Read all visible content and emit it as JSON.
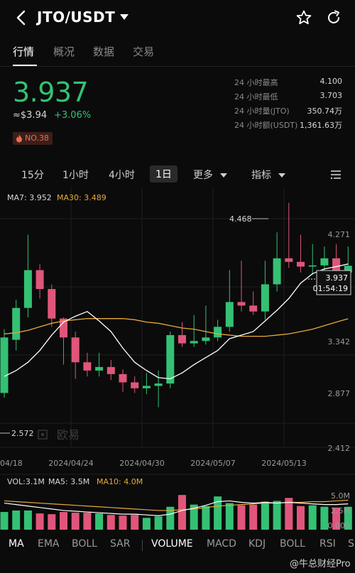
{
  "header": {
    "pair": "JTO/USDT"
  },
  "tabs": [
    {
      "label": "行情",
      "active": true
    },
    {
      "label": "概况",
      "active": false
    },
    {
      "label": "数据",
      "active": false
    },
    {
      "label": "交易",
      "active": false
    }
  ],
  "ticker": {
    "price": "3.937",
    "approx_price": "≈$3.94",
    "change": "+3.06%",
    "hot_rank": "NO.38"
  },
  "stats": [
    {
      "label": "24 小时最高",
      "value": "4.100"
    },
    {
      "label": "24 小时最低",
      "value": "3.703"
    },
    {
      "label": "24 小时量(JTO)",
      "value": "350.74万"
    },
    {
      "label": "24 小时额(USDT)",
      "value": "1,361.63万"
    }
  ],
  "intervals": [
    {
      "label": "15分",
      "active": false
    },
    {
      "label": "1小时",
      "active": false
    },
    {
      "label": "4小时",
      "active": false
    },
    {
      "label": "1日",
      "active": true
    },
    {
      "label": "更多",
      "active": false
    },
    {
      "label": "指标",
      "active": false
    }
  ],
  "indicators": {
    "ma7": "MA7: 3.952",
    "ma30": "MA30: 3.489"
  },
  "price_axis": [
    "4.271",
    "3.342",
    "2.877",
    "2.412"
  ],
  "date_axis": [
    "04/18",
    "2024/04/24",
    "2024/04/30",
    "2024/05/07",
    "2024/05/13"
  ],
  "high_marker": "4.468",
  "low_marker": "2.572",
  "current_tag": {
    "price": "3.937",
    "countdown": "01:54:19"
  },
  "watermark_brand": "欧易",
  "volume": {
    "vol": "VOL:3.1M",
    "ma5": "MA5: 3.5M",
    "ma10": "MA10: 4.0M",
    "axis": [
      "5.0M",
      "2.5M",
      "0.000"
    ]
  },
  "bottom_tabs": [
    {
      "label": "MA",
      "active": true
    },
    {
      "label": "EMA",
      "active": false
    },
    {
      "label": "BOLL",
      "active": false
    },
    {
      "label": "SAR",
      "active": false
    },
    {
      "label": "VOLUME",
      "active": true
    },
    {
      "label": "MACD",
      "active": false
    },
    {
      "label": "KDJ",
      "active": false
    },
    {
      "label": "BOLL",
      "active": false
    },
    {
      "label": "RSI",
      "active": false
    },
    {
      "label": "S",
      "active": false
    }
  ],
  "footer_watermark": "@牛总财经Pro",
  "colors": {
    "up": "#34c174",
    "down": "#e0567a",
    "ma7": "#ffffff",
    "ma30": "#e8a93a",
    "bg": "#0b0b0b"
  },
  "chart_data": {
    "type": "candlestick",
    "x": [
      "04/16",
      "04/17",
      "04/18",
      "04/19",
      "04/20",
      "04/21",
      "04/22",
      "04/23",
      "04/24",
      "04/25",
      "04/26",
      "04/27",
      "04/28",
      "04/29",
      "04/30",
      "05/01",
      "05/02",
      "05/03",
      "05/04",
      "05/05",
      "05/06",
      "05/07",
      "05/08",
      "05/09",
      "05/10",
      "05/11",
      "05/12",
      "05/13",
      "05/14",
      "05/15"
    ],
    "open": [
      2.86,
      3.31,
      3.58,
      3.9,
      3.74,
      3.49,
      3.33,
      3.12,
      3.05,
      3.08,
      3.02,
      2.95,
      2.9,
      2.92,
      2.94,
      3.35,
      3.28,
      3.3,
      3.33,
      3.42,
      3.63,
      3.6,
      3.55,
      3.78,
      4.0,
      3.97,
      3.93,
      3.94,
      4.0,
      3.88
    ],
    "close": [
      3.33,
      3.58,
      3.9,
      3.74,
      3.49,
      3.33,
      3.12,
      3.05,
      3.08,
      3.02,
      2.95,
      2.9,
      2.92,
      2.94,
      3.35,
      3.28,
      3.3,
      3.33,
      3.42,
      3.63,
      3.6,
      3.55,
      3.78,
      4.0,
      3.97,
      3.93,
      3.94,
      4.0,
      3.88,
      3.937
    ],
    "high": [
      3.4,
      3.65,
      4.2,
      3.95,
      3.78,
      3.5,
      3.38,
      3.2,
      3.2,
      3.14,
      3.06,
      3.0,
      3.03,
      3.05,
      3.38,
      3.46,
      3.52,
      3.6,
      3.48,
      3.9,
      3.98,
      3.72,
      3.98,
      4.22,
      4.47,
      4.2,
      4.12,
      4.1,
      4.12,
      4.1
    ],
    "low": [
      2.82,
      3.22,
      3.5,
      3.66,
      3.42,
      3.1,
      2.98,
      3.0,
      3.0,
      2.97,
      2.87,
      2.86,
      2.85,
      2.74,
      2.9,
      3.25,
      3.25,
      3.27,
      3.3,
      3.38,
      3.55,
      3.52,
      3.48,
      3.72,
      3.92,
      3.88,
      3.86,
      3.8,
      3.85,
      3.84
    ],
    "ma7": [
      3.0,
      3.05,
      3.12,
      3.22,
      3.35,
      3.46,
      3.51,
      3.55,
      3.47,
      3.38,
      3.24,
      3.12,
      3.05,
      2.99,
      2.98,
      3.03,
      3.1,
      3.16,
      3.22,
      3.32,
      3.35,
      3.38,
      3.47,
      3.56,
      3.66,
      3.79,
      3.87,
      3.91,
      3.93,
      3.952
    ],
    "ma30": [
      3.36,
      3.37,
      3.39,
      3.42,
      3.45,
      3.47,
      3.48,
      3.49,
      3.49,
      3.49,
      3.49,
      3.48,
      3.46,
      3.45,
      3.43,
      3.41,
      3.4,
      3.38,
      3.36,
      3.35,
      3.34,
      3.34,
      3.34,
      3.35,
      3.36,
      3.38,
      3.4,
      3.43,
      3.46,
      3.489
    ],
    "ylim": [
      2.4,
      4.6
    ],
    "volume": [
      2.4,
      2.6,
      2.6,
      2.2,
      2.1,
      2.4,
      2.3,
      2.3,
      2.2,
      2.0,
      1.9,
      2.0,
      1.6,
      1.8,
      3.1,
      4.7,
      3.4,
      3.2,
      4.5,
      3.6,
      3.3,
      3.4,
      3.8,
      3.9,
      4.3,
      3.2,
      3.3,
      3.1,
      3.0,
      3.1
    ],
    "vol_ma5": [
      3.6,
      3.4,
      3.2,
      3.0,
      2.8,
      2.6,
      2.5,
      2.4,
      2.3,
      2.2,
      2.1,
      2.1,
      2.0,
      1.9,
      2.1,
      2.6,
      2.9,
      3.3,
      3.8,
      3.9,
      3.7,
      3.6,
      3.7,
      3.6,
      3.7,
      3.6,
      3.5,
      3.4,
      3.4,
      3.5
    ],
    "vol_ma10": [
      3.9,
      3.8,
      3.7,
      3.6,
      3.5,
      3.4,
      3.3,
      3.2,
      3.1,
      3.0,
      2.9,
      2.8,
      2.7,
      2.6,
      2.6,
      2.7,
      2.8,
      3.0,
      3.2,
      3.3,
      3.4,
      3.5,
      3.6,
      3.6,
      3.7,
      3.7,
      3.8,
      3.8,
      3.9,
      4.0
    ],
    "vol_ylim": [
      0,
      5.0
    ]
  }
}
